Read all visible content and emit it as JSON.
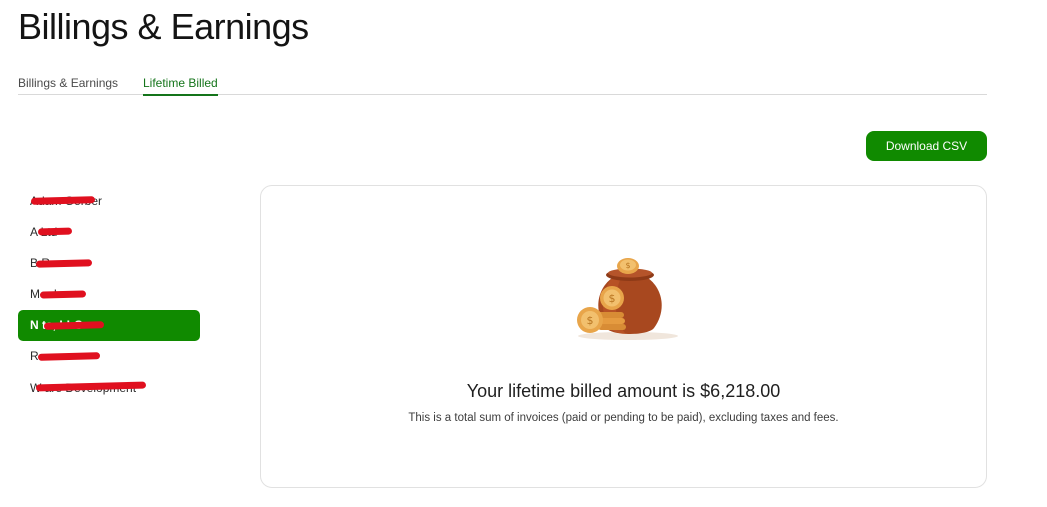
{
  "page": {
    "title": "Billings & Earnings"
  },
  "tabs": [
    {
      "label": "Billings & Earnings",
      "active": false
    },
    {
      "label": "Lifetime Billed",
      "active": true
    }
  ],
  "toolbar": {
    "download_label": "Download CSV"
  },
  "clients": [
    {
      "label": "Adam Gerber",
      "redacted": true
    },
    {
      "label": "A Ltd",
      "redacted": true
    },
    {
      "label": "B R",
      "redacted": true
    },
    {
      "label": "M nd",
      "redacted": true
    },
    {
      "label": "N ts, LLC",
      "redacted": true,
      "selected": true
    },
    {
      "label": "R",
      "redacted": true
    },
    {
      "label": "W are Development",
      "redacted": true
    }
  ],
  "summary": {
    "heading": "Your lifetime billed amount is $6,218.00",
    "subtext": "This is a total sum of invoices (paid or pending to be paid), excluding taxes and fees."
  },
  "colors": {
    "accent": "#108a00",
    "tab_active": "#14741a",
    "redaction": "#e0101f"
  },
  "icons": {
    "illustration": "money-pot-icon"
  }
}
